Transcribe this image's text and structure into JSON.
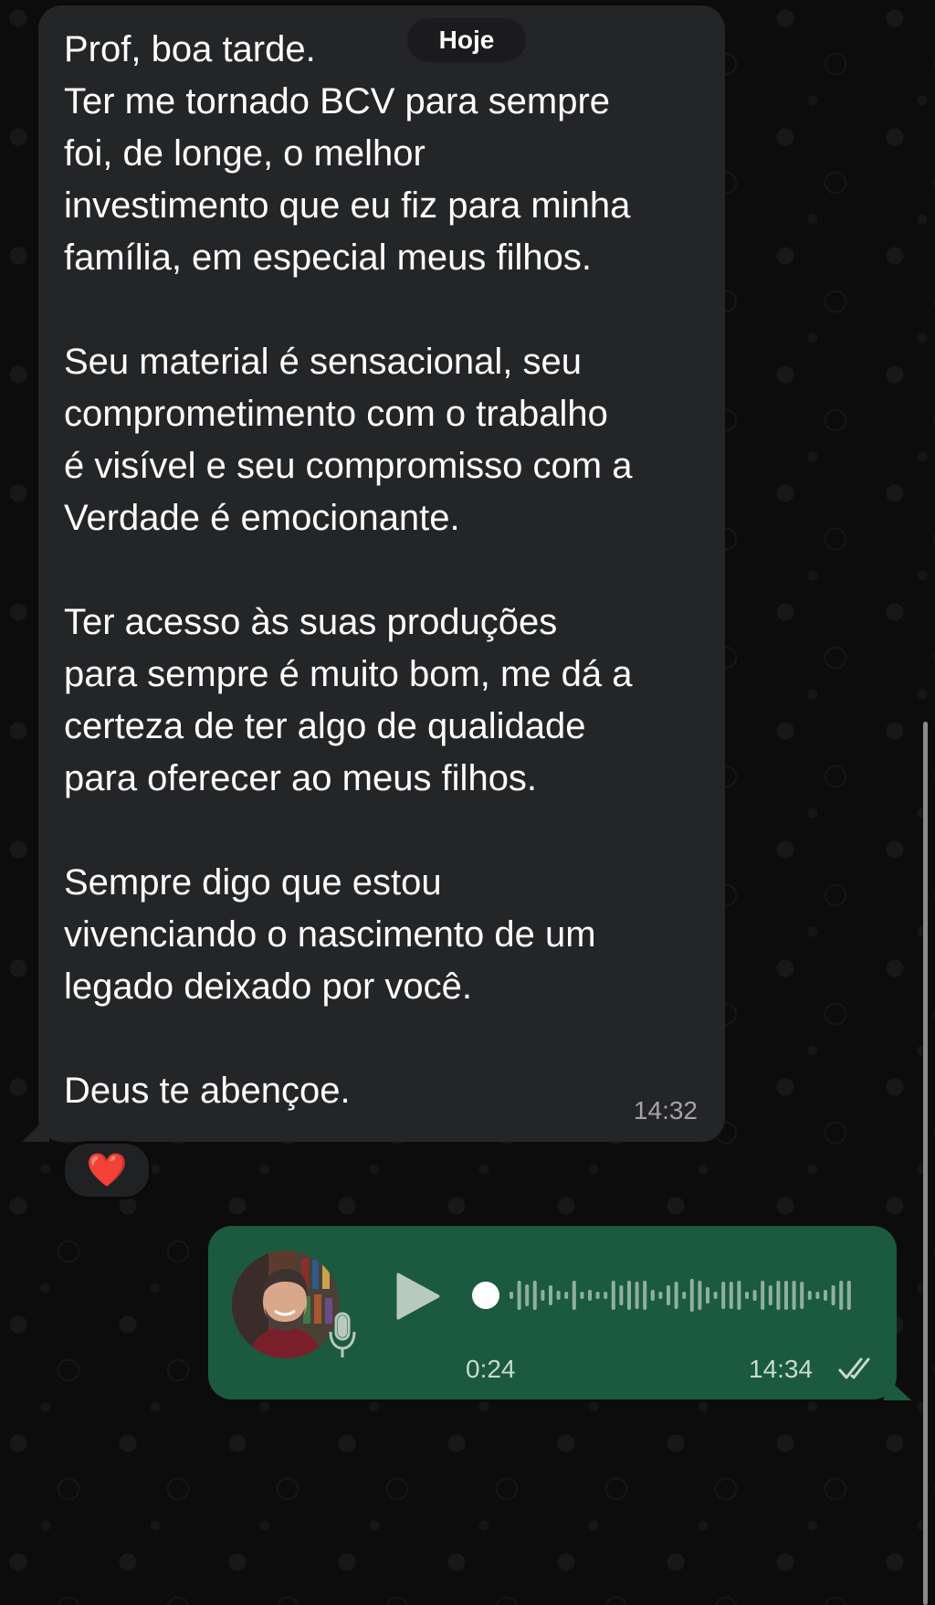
{
  "chat": {
    "date_label": "Hoje",
    "incoming": {
      "text": "Prof, boa tarde.\nTer me tornado BCV para sempre\nfoi, de longe, o melhor\ninvestimento que eu fiz para minha\nfamília, em especial meus filhos.\n\nSeu material é sensacional, seu\ncomprometimento com o trabalho\né visível e seu compromisso com a\nVerdade é emocionante.\n\nTer acesso às suas produções\npara sempre é muito bom, me dá a\ncerteza de ter algo de qualidade\npara oferecer ao meus filhos.\n\nSempre digo que estou\nvivenciando o nascimento de um\nlegado deixado por você.\n\nDeus te abençoe.",
      "time": "14:32",
      "reaction": "❤️"
    },
    "outgoing_voice": {
      "duration": "0:24",
      "time": "14:34",
      "progress": 0,
      "status_icon": "double-check-icon"
    }
  },
  "colors": {
    "incoming_bubble": "#242527",
    "outgoing_bubble": "#1b5a3e",
    "background": "#0b0b0c"
  }
}
